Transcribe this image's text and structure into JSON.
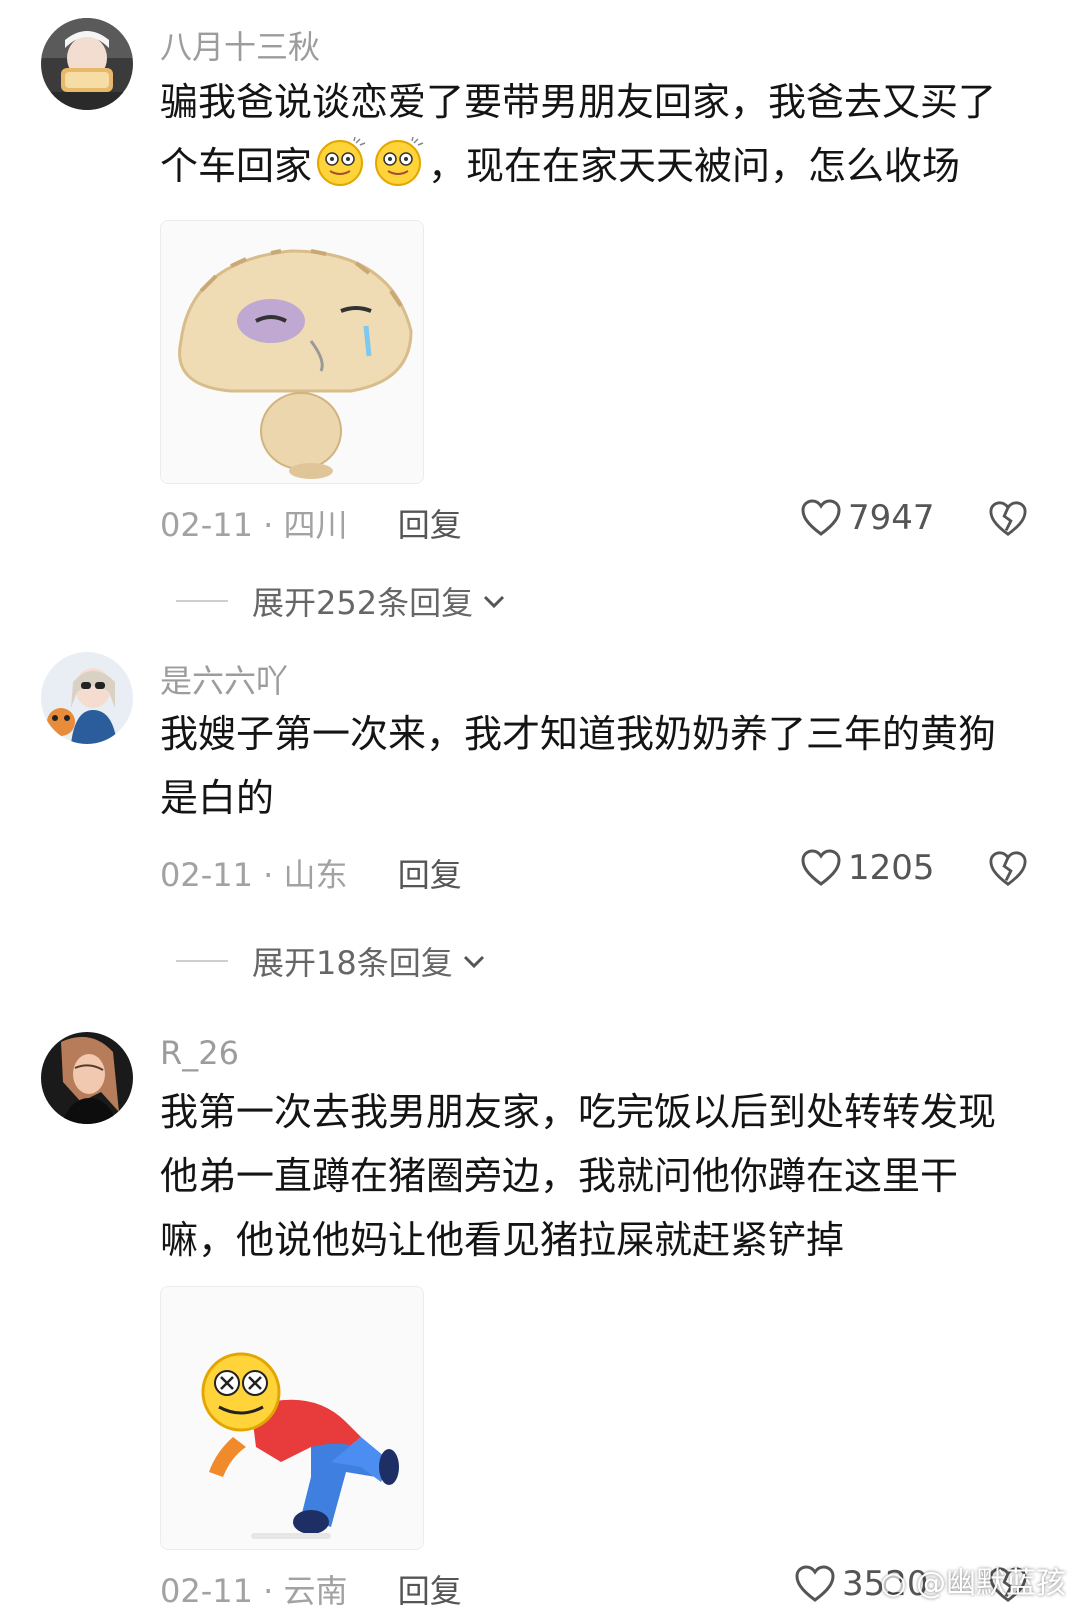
{
  "comments": [
    {
      "username": "八月十三秋",
      "text_line1": "骗我爸说谈恋爱了要带男朋友回家，我爸去又买了",
      "text_line2_start": "个车回家",
      "text_line2_end": "，现在在家天天被问，怎么收场",
      "date": "02-11",
      "region": "· 四川",
      "reply_label": "回复",
      "likes": "7947",
      "expand_label": "展开252条回复"
    },
    {
      "username": "是六六吖",
      "text": "我嫂子第一次来，我才知道我奶奶养了三年的黄狗是白的",
      "date": "02-11",
      "region": "· 山东",
      "reply_label": "回复",
      "likes": "1205",
      "expand_label": "展开18条回复"
    },
    {
      "username": "R_26",
      "text": "我第一次去我男朋友家，吃完饭以后到处转转发现他弟一直蹲在猪圈旁边，我就问他你蹲在这里干嘛，他说他妈让他看见猪拉屎就赶紧铲掉",
      "date": "02-11",
      "region": "· 云南",
      "reply_label": "回复",
      "likes": "3520"
    }
  ],
  "watermark": "@幽默蓝孩",
  "icons": {
    "like": "heart-outline-icon",
    "dislike": "broken-heart-icon",
    "expand": "chevron-down-icon",
    "emoji": "dizzy-face-emoji"
  },
  "colors": {
    "username": "#9c9c9c",
    "text": "#141414",
    "meta": "#a2a2a2"
  }
}
